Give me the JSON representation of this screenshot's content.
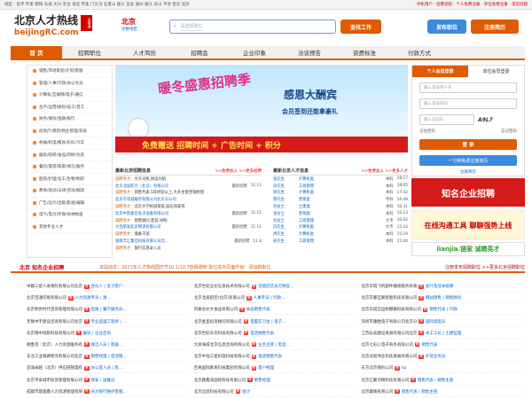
{
  "topbar": {
    "left": "地区：昌平 怀柔 朝阳 东城 大兴 丰台 海淀 怀柔 门头沟 石景山 顺义 宣武 通州 顺义 房山 平谷 密云 延庆",
    "right": "·手机用户 · 招聘流程 · 个人免费注册 · 单位免费注册 · 常见问题"
  },
  "logo": {
    "name": "北京人才热线",
    "domain": "beijingRC.com",
    "seal": "百事通"
  },
  "city": {
    "name": "北京",
    "switch": "切换地区"
  },
  "search": {
    "placeholder": "请选择职位",
    "button": "查找工作"
  },
  "header_buttons": {
    "post": "发布职位",
    "resume": "注册简历"
  },
  "nav": [
    "首 页",
    "招聘职位",
    "人才简历",
    "招聘会",
    "企业印象",
    "洽谈预告",
    "资费标准",
    "付款方式"
  ],
  "side": [
    "销售/市场策划/外贸/客服",
    "管理/人事/行政/办公文员",
    "计算机/互联网/电子/通信",
    "生产/运营/质检/技工/普工",
    "财务/保险/金融/银行",
    "房地产/建筑/物业管理/装安",
    "机械/机电/模具/乐队/汽车",
    "服装/纺织/食品/印刷/包装",
    "餐饮/旅游/家庭/保洁/服务",
    "医院/护理/化工/生物/制药",
    "教育/培训/法律/咨询/翻译",
    "广告/设计/出版/影视/编辑",
    "电气/电力/环保/农林牧渔",
    "其他专业人才"
  ],
  "banner": {
    "title": "暖冬盛惠招聘季",
    "right_title": "感恩大酬宾",
    "right_sub": "会员签到还能拿豪礼",
    "strip": "免费赠送 招聘时间 + 广告时间 + 积分"
  },
  "login": {
    "tab_personal": "个人会员登录",
    "tab_company": "单位会员登录",
    "user": "输入登录用户名",
    "pass": "输入登录密码",
    "code": "输入验证码",
    "captcha": "A9L7",
    "remember": "记住密码",
    "forgot": "忘记密码",
    "submit": "登 录",
    "register": "一分钟免费注册简历",
    "reg_label": "注册简历"
  },
  "panels": {
    "resumes": {
      "title": "最新北京招聘信息",
      "more": ">>免费加入 >>更多招聘",
      "rows": [
        {
          "a": "诚聘英才",
          "b": "文车司机,财运司机",
          "c": "",
          "d": ""
        },
        {
          "a": "北京北居航空（北京）有限公司",
          "b": "",
          "c": "最新招聘",
          "d": "11.11"
        },
        {
          "a": "诚聘英才",
          "b": "销售代表,5年经验以上,大开主管营销经理",
          "c": "",
          "d": ""
        },
        {
          "a": "北京市华诚服务有限公司北京分公司",
          "b": "",
          "c": "",
          "d": ""
        },
        {
          "a": "诚聘英才",
          "b": "北京大学校园保安,励志保安等",
          "c": "",
          "d": ""
        },
        {
          "a": "北京中凯富佳电子设备有限公司",
          "b": "",
          "c": "最新招聘",
          "d": "11.11"
        },
        {
          "a": "诚聘英才",
          "b": "销售顾问,售前,导购",
          "c": "",
          "d": ""
        },
        {
          "a": "大连航发北京物流有限公司",
          "b": "",
          "c": "最新招聘",
          "d": "11.11"
        },
        {
          "a": "诚聘英才",
          "b": "储备干部",
          "c": "",
          "d": ""
        },
        {
          "a": "湖南丰汇集信科技有限公司北...",
          "b": "",
          "c": "最新招聘",
          "d": "11.8"
        },
        {
          "a": "诚聘英才",
          "b": "银行信息录入员",
          "c": "",
          "d": ""
        }
      ]
    },
    "talents": {
      "title": "最新北京人才信息",
      "more": ">>免费加入 >>更多人才",
      "rows": [
        {
          "a": "张先生",
          "b": "计算机类",
          "c": "本科",
          "d": "18:17"
        },
        {
          "a": "刘先生",
          "b": "工商管理",
          "c": "本科",
          "d": "18:05"
        },
        {
          "a": "周先生",
          "b": "计算机类",
          "c": "本科",
          "d": "17:42"
        },
        {
          "a": "郭先生",
          "b": "营销类",
          "c": "专科",
          "d": "16:48"
        },
        {
          "a": "刘女士",
          "b": "土建类",
          "c": "本科",
          "d": "16:31"
        },
        {
          "a": "张女士",
          "b": "营销类",
          "c": "本科",
          "d": "16:13"
        },
        {
          "a": "刘女士",
          "b": "工商管理",
          "c": "大专",
          "d": "16:02"
        },
        {
          "a": "白先生",
          "b": "计算机类",
          "c": "大专",
          "d": "15:33"
        },
        {
          "a": "周先生",
          "b": "计算机类",
          "c": "本科",
          "d": "15:29"
        },
        {
          "a": "徐先生",
          "b": "工商管理",
          "c": "本科",
          "d": "15:20"
        }
      ]
    }
  },
  "ads": {
    "a1": "知名企业招聘",
    "a2": "在线沟通工具 聊聊强势上线",
    "a3": "lianjia.链家 诚聘英才"
  },
  "section": {
    "title": "北京 知名企业招聘",
    "marquee": "本站动态：2021年人才热线国庆节10.1/10.7放假通知  职位发布页面升级：添加新职位",
    "right": "注册发布招聘职位 >>更多北京招聘职位"
  },
  "companies": [
    [
      "中都三星人寿保险有限公司北京",
      "合伙人 | 见习客户..."
    ],
    [
      "北京世纪立达信息技术有限公司",
      "连锁店店员可预支..."
    ],
    [
      "北京华瑞飞机部件维修服务有限",
      "会计及成本核算"
    ],
    [
      "北京百通印刷有限公司",
      "人力资源专员 | 源..."
    ],
    [
      "北京北居航空(北京)有限公司",
      "人事专员 | 行政..."
    ],
    [
      "北京京都互联智能科技有限公司",
      "网站销售 | 销售顾问"
    ],
    [
      "北京明亮时代咨询管理有限公司",
      "后厨 | 餐厅服务员..."
    ],
    [
      "内蒙古达大食品有限公司",
      "食品销售代表"
    ],
    [
      "北京华成迈运和健康科技有限公司",
      "销售代表 | 行政"
    ],
    [
      "无锡中宇建设咨询有限公司北京",
      "专业监理工程师 | ..."
    ],
    [
      "北京金圣投资顾问有限公司",
      "电脑实习生 | 电子..."
    ],
    [
      "深圳市康胜电子有限公司北京分",
      "城际调度员"
    ],
    [
      "北京锦中瑞斯科技有限公司",
      "编导 | 企业咨询"
    ],
    [
      "北京世纪天华科技有限公司",
      "电话销售代表"
    ],
    [
      "江苏弘高建设发展有限公司北京",
      "木工工长 | 土建监理"
    ],
    [
      "德鲁克（北京）人力资源服务有",
      "保洁人员 | 客服..."
    ],
    [
      "大梁海城北京信息咨询有限公司",
      "业务主管 | 电话..."
    ],
    [
      "北京七彩心电子商务有限公司",
      "销售代表"
    ],
    [
      "东北工业铁路物流有限公司北京",
      "销售经理 | 电话销..."
    ],
    [
      "北京中恒三星机电科技有限公司",
      "电话销售代表"
    ],
    [
      "北京龙程伟业科技发展有限公司",
      "外贸业务员"
    ],
    [
      "首诚卓越（北京）供应链管理有",
      "办公室人员 | 客..."
    ],
    [
      "百真国际教育科技集团有限公司",
      "客户经理"
    ],
    [
      "东方北京保险公司",
      "ha"
    ],
    [
      "北京平安城市投资管理有限公司",
      "保安 | 送餐员"
    ],
    [
      "北京路鑫泽国际科技有限公司",
      "销售经理"
    ],
    [
      "北京汇聚点精科技有限公司",
      "销售代表 | 销售主管"
    ],
    [
      "成都市蓉蓉鑫人力资源管理有限",
      "光大银行维护客服..."
    ],
    [
      "北京迈思科技有限公司",
      "会计"
    ],
    [
      "北京康辉有限公司",
      "销售代表 | 销售主管"
    ]
  ]
}
